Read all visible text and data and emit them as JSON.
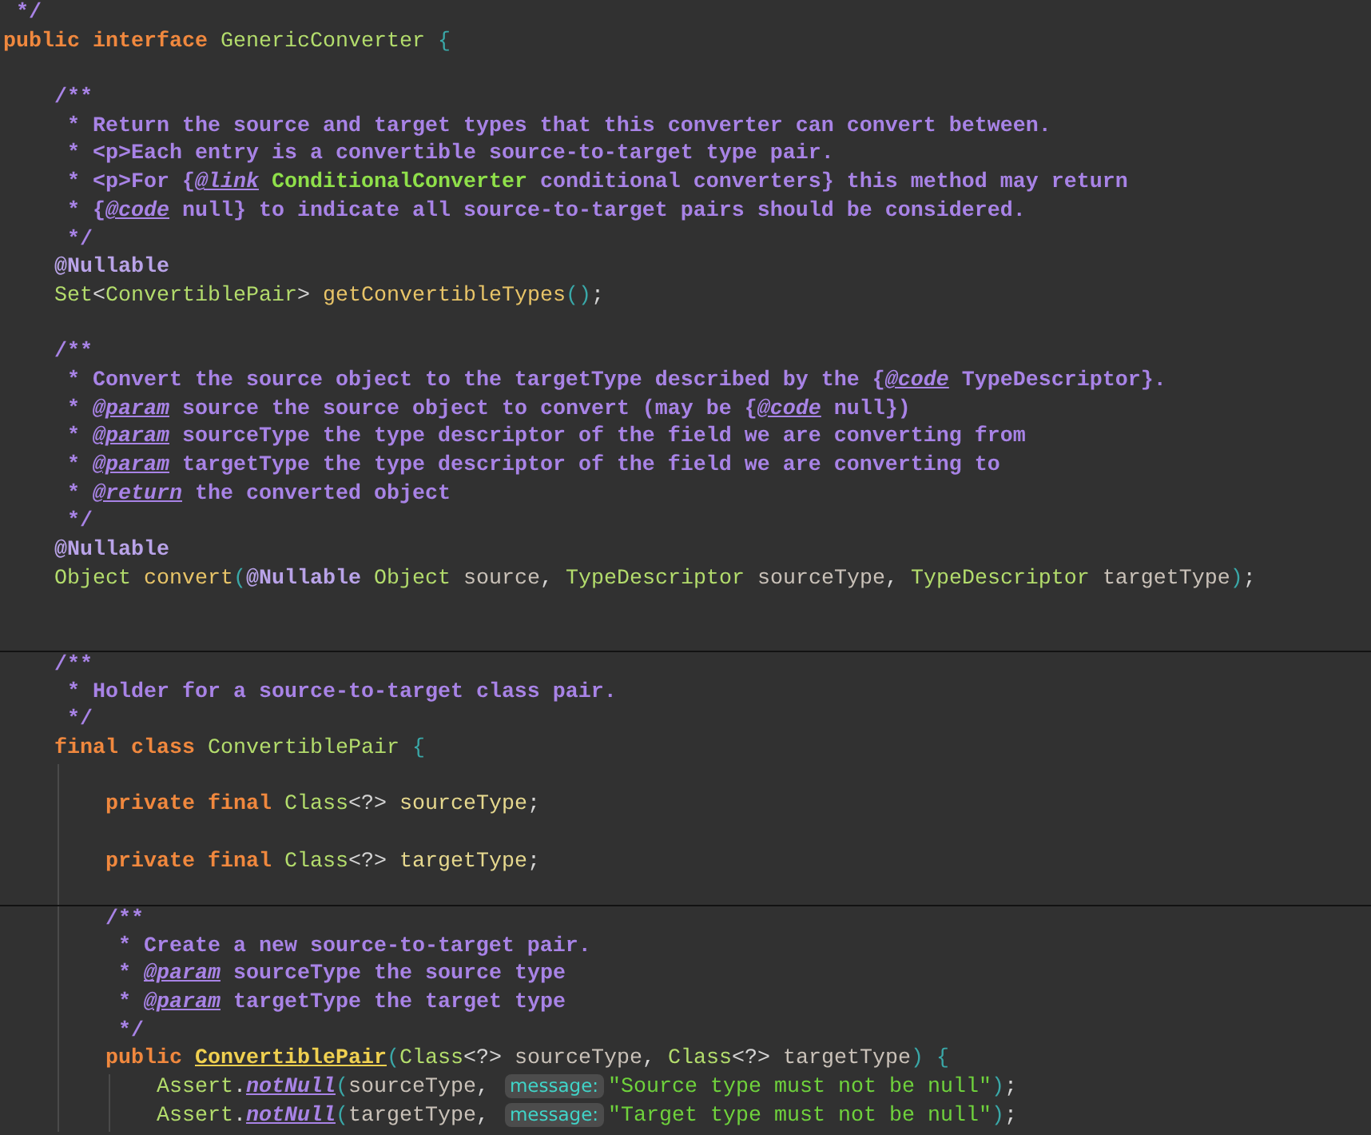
{
  "editor": {
    "lines": [
      {
        "separator": false,
        "tokens": [
          {
            "kind": "comment",
            "text": " */"
          }
        ]
      },
      {
        "separator": false,
        "tokens": [
          {
            "kind": "keyword",
            "text": "public interface "
          },
          {
            "kind": "type",
            "text": "GenericConverter"
          },
          {
            "kind": "brace",
            "text": " {"
          }
        ]
      },
      {
        "separator": false
      },
      {
        "separator": false,
        "tokens": [
          {
            "kind": "comment",
            "text": "    /**"
          }
        ]
      },
      {
        "separator": false,
        "tokens": [
          {
            "kind": "comment",
            "text": "     * Return the source and target types that this converter can convert between."
          }
        ]
      },
      {
        "separator": false,
        "tokens": [
          {
            "kind": "comment",
            "text": "     * <p>Each entry is a convertible source-to-target type pair."
          }
        ]
      },
      {
        "separator": false,
        "tokens": [
          {
            "kind": "comment",
            "text": "     * <p>For {"
          },
          {
            "kind": "doctag",
            "text": "@link"
          },
          {
            "kind": "doclink",
            "text": " ConditionalConverter"
          },
          {
            "kind": "comment",
            "text": " conditional converters} this method may return"
          }
        ]
      },
      {
        "separator": false,
        "tokens": [
          {
            "kind": "comment",
            "text": "     * {"
          },
          {
            "kind": "doctag",
            "text": "@code"
          },
          {
            "kind": "comment",
            "text": " null} to indicate all source-to-target pairs should be considered."
          }
        ]
      },
      {
        "separator": false,
        "tokens": [
          {
            "kind": "comment",
            "text": "     */"
          }
        ]
      },
      {
        "separator": false,
        "tokens": [
          {
            "kind": "annotation",
            "text": "    @Nullable"
          }
        ]
      },
      {
        "separator": false,
        "tokens": [
          {
            "kind": "type",
            "text": "    Set"
          },
          {
            "kind": "plain",
            "text": "<"
          },
          {
            "kind": "type",
            "text": "ConvertiblePair"
          },
          {
            "kind": "plain",
            "text": "> "
          },
          {
            "kind": "method",
            "text": "getConvertibleTypes"
          },
          {
            "kind": "brace",
            "text": "()"
          },
          {
            "kind": "plain",
            "text": ";"
          }
        ]
      },
      {
        "separator": false
      },
      {
        "separator": false,
        "tokens": [
          {
            "kind": "comment",
            "text": "    /**"
          }
        ]
      },
      {
        "separator": false,
        "tokens": [
          {
            "kind": "comment",
            "text": "     * Convert the source object to the targetType described by the {"
          },
          {
            "kind": "doctag",
            "text": "@code"
          },
          {
            "kind": "comment",
            "text": " TypeDescriptor}."
          }
        ]
      },
      {
        "separator": false,
        "tokens": [
          {
            "kind": "comment",
            "text": "     * "
          },
          {
            "kind": "doctag",
            "text": "@param"
          },
          {
            "kind": "comment",
            "text": " source the source object to convert (may be {"
          },
          {
            "kind": "doctag",
            "text": "@code"
          },
          {
            "kind": "comment",
            "text": " null})"
          }
        ]
      },
      {
        "separator": false,
        "tokens": [
          {
            "kind": "comment",
            "text": "     * "
          },
          {
            "kind": "doctag",
            "text": "@param"
          },
          {
            "kind": "comment",
            "text": " sourceType the type descriptor of the field we are converting from"
          }
        ]
      },
      {
        "separator": false,
        "tokens": [
          {
            "kind": "comment",
            "text": "     * "
          },
          {
            "kind": "doctag",
            "text": "@param"
          },
          {
            "kind": "comment",
            "text": " targetType the type descriptor of the field we are converting to"
          }
        ]
      },
      {
        "separator": false,
        "tokens": [
          {
            "kind": "comment",
            "text": "     * "
          },
          {
            "kind": "doctag",
            "text": "@return"
          },
          {
            "kind": "comment",
            "text": " the converted object"
          }
        ]
      },
      {
        "separator": false,
        "tokens": [
          {
            "kind": "comment",
            "text": "     */"
          }
        ]
      },
      {
        "separator": false,
        "tokens": [
          {
            "kind": "annotation",
            "text": "    @Nullable"
          }
        ]
      },
      {
        "separator": false,
        "tokens": [
          {
            "kind": "type",
            "text": "    Object"
          },
          {
            "kind": "method",
            "text": " convert"
          },
          {
            "kind": "brace",
            "text": "("
          },
          {
            "kind": "annotation",
            "text": "@Nullable"
          },
          {
            "kind": "type",
            "text": " Object"
          },
          {
            "kind": "param",
            "text": " source"
          },
          {
            "kind": "plain",
            "text": ", "
          },
          {
            "kind": "type",
            "text": "TypeDescriptor"
          },
          {
            "kind": "param",
            "text": " sourceType"
          },
          {
            "kind": "plain",
            "text": ", "
          },
          {
            "kind": "type",
            "text": "TypeDescriptor"
          },
          {
            "kind": "param",
            "text": " targetType"
          },
          {
            "kind": "brace",
            "text": ")"
          },
          {
            "kind": "plain",
            "text": ";"
          }
        ]
      },
      {
        "separator": false
      },
      {
        "separator": false
      },
      {
        "separator": true,
        "tokens": [
          {
            "kind": "comment",
            "text": "    /**"
          }
        ]
      },
      {
        "separator": false,
        "tokens": [
          {
            "kind": "comment",
            "text": "     * Holder for a source-to-target class pair."
          }
        ]
      },
      {
        "separator": false,
        "tokens": [
          {
            "kind": "comment",
            "text": "     */"
          }
        ]
      },
      {
        "separator": false,
        "tokens": [
          {
            "kind": "keyword",
            "text": "    final class "
          },
          {
            "kind": "type",
            "text": "ConvertiblePair"
          },
          {
            "kind": "brace",
            "text": " {"
          }
        ]
      },
      {
        "separator": false,
        "guides": true
      },
      {
        "separator": false,
        "tokens": [
          {
            "kind": "keyword",
            "text": "        private final "
          },
          {
            "kind": "type",
            "text": "Class"
          },
          {
            "kind": "plain",
            "text": "<?> "
          },
          {
            "kind": "field",
            "text": "sourceType"
          },
          {
            "kind": "plain",
            "text": ";"
          }
        ]
      },
      {
        "separator": false,
        "guides": true
      },
      {
        "separator": false,
        "tokens": [
          {
            "kind": "keyword",
            "text": "        private final "
          },
          {
            "kind": "type",
            "text": "Class"
          },
          {
            "kind": "plain",
            "text": "<?> "
          },
          {
            "kind": "field",
            "text": "targetType"
          },
          {
            "kind": "plain",
            "text": ";"
          }
        ]
      },
      {
        "separator": false,
        "guides": true
      },
      {
        "separator": true,
        "tokens": [
          {
            "kind": "comment",
            "text": "        /**"
          }
        ]
      },
      {
        "separator": false,
        "tokens": [
          {
            "kind": "comment",
            "text": "         * Create a new source-to-target pair."
          }
        ]
      },
      {
        "separator": false,
        "tokens": [
          {
            "kind": "comment",
            "text": "         * "
          },
          {
            "kind": "doctag",
            "text": "@param"
          },
          {
            "kind": "comment",
            "text": " sourceType the source type"
          }
        ]
      },
      {
        "separator": false,
        "tokens": [
          {
            "kind": "comment",
            "text": "         * "
          },
          {
            "kind": "doctag",
            "text": "@param"
          },
          {
            "kind": "comment",
            "text": " targetType the target type"
          }
        ]
      },
      {
        "separator": false,
        "tokens": [
          {
            "kind": "comment",
            "text": "         */"
          }
        ]
      },
      {
        "separator": false,
        "tokens": [
          {
            "kind": "keyword",
            "text": "        public "
          },
          {
            "kind": "constructor",
            "text": "ConvertiblePair"
          },
          {
            "kind": "brace",
            "text": "("
          },
          {
            "kind": "type",
            "text": "Class"
          },
          {
            "kind": "plain",
            "text": "<?> "
          },
          {
            "kind": "param",
            "text": "sourceType"
          },
          {
            "kind": "plain",
            "text": ", "
          },
          {
            "kind": "type",
            "text": "Class"
          },
          {
            "kind": "plain",
            "text": "<?> "
          },
          {
            "kind": "param",
            "text": "targetType"
          },
          {
            "kind": "brace",
            "text": ") {"
          }
        ]
      },
      {
        "separator": false,
        "tokens": [
          {
            "kind": "type",
            "text": "            Assert"
          },
          {
            "kind": "plain",
            "text": "."
          },
          {
            "kind": "static",
            "text": "notNull"
          },
          {
            "kind": "brace",
            "text": "("
          },
          {
            "kind": "param",
            "text": "sourceType"
          },
          {
            "kind": "plain",
            "text": ", "
          },
          {
            "kind": "hint",
            "text": "message:"
          },
          {
            "kind": "string",
            "text": "\"Source type must not be null\""
          },
          {
            "kind": "brace",
            "text": ")"
          },
          {
            "kind": "plain",
            "text": ";"
          }
        ]
      },
      {
        "separator": false,
        "tokens": [
          {
            "kind": "type",
            "text": "            Assert"
          },
          {
            "kind": "plain",
            "text": "."
          },
          {
            "kind": "static",
            "text": "notNull"
          },
          {
            "kind": "brace",
            "text": "("
          },
          {
            "kind": "param",
            "text": "targetType"
          },
          {
            "kind": "plain",
            "text": ", "
          },
          {
            "kind": "hint",
            "text": "message:"
          },
          {
            "kind": "string",
            "text": "\"Target type must not be null\""
          },
          {
            "kind": "brace",
            "text": ")"
          },
          {
            "kind": "plain",
            "text": ";"
          }
        ]
      }
    ]
  }
}
